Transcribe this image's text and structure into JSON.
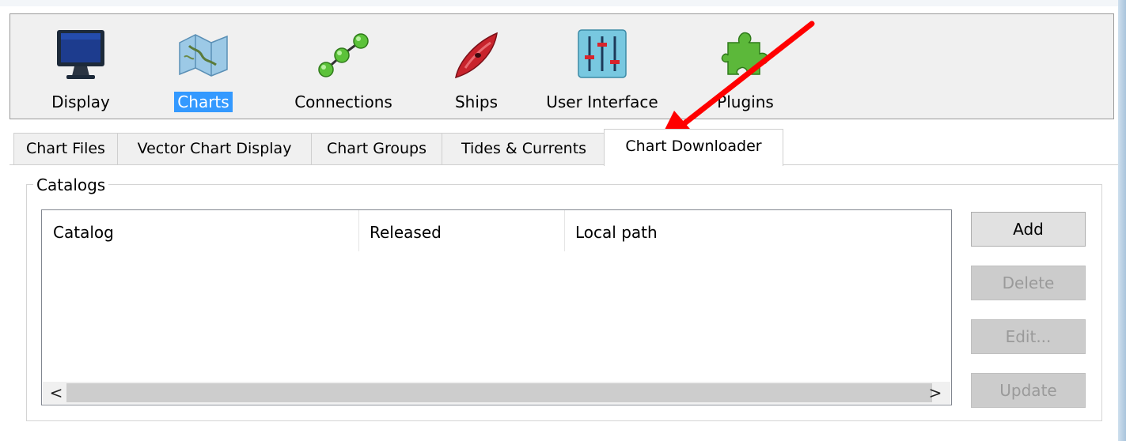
{
  "toolbar": {
    "items": [
      {
        "label": "Display",
        "icon": "monitor-icon"
      },
      {
        "label": "Charts",
        "icon": "charts-icon",
        "selected": true
      },
      {
        "label": "Connections",
        "icon": "connections-icon"
      },
      {
        "label": "Ships",
        "icon": "ship-icon"
      },
      {
        "label": "User Interface",
        "icon": "sliders-icon"
      },
      {
        "label": "Plugins",
        "icon": "puzzle-icon"
      }
    ]
  },
  "tabs": [
    {
      "label": "Chart Files"
    },
    {
      "label": "Vector Chart Display"
    },
    {
      "label": "Chart Groups"
    },
    {
      "label": "Tides & Currents"
    },
    {
      "label": "Chart Downloader",
      "active": true
    }
  ],
  "catalogs": {
    "title": "Catalogs",
    "columns": [
      "Catalog",
      "Released",
      "Local path"
    ],
    "rows": [],
    "scroll_left": "<",
    "scroll_right": ">"
  },
  "buttons": {
    "add": "Add",
    "delete": "Delete",
    "edit": "Edit...",
    "update": "Update"
  },
  "colors": {
    "selection": "#3399ff",
    "annotation_arrow": "#ff0000"
  }
}
